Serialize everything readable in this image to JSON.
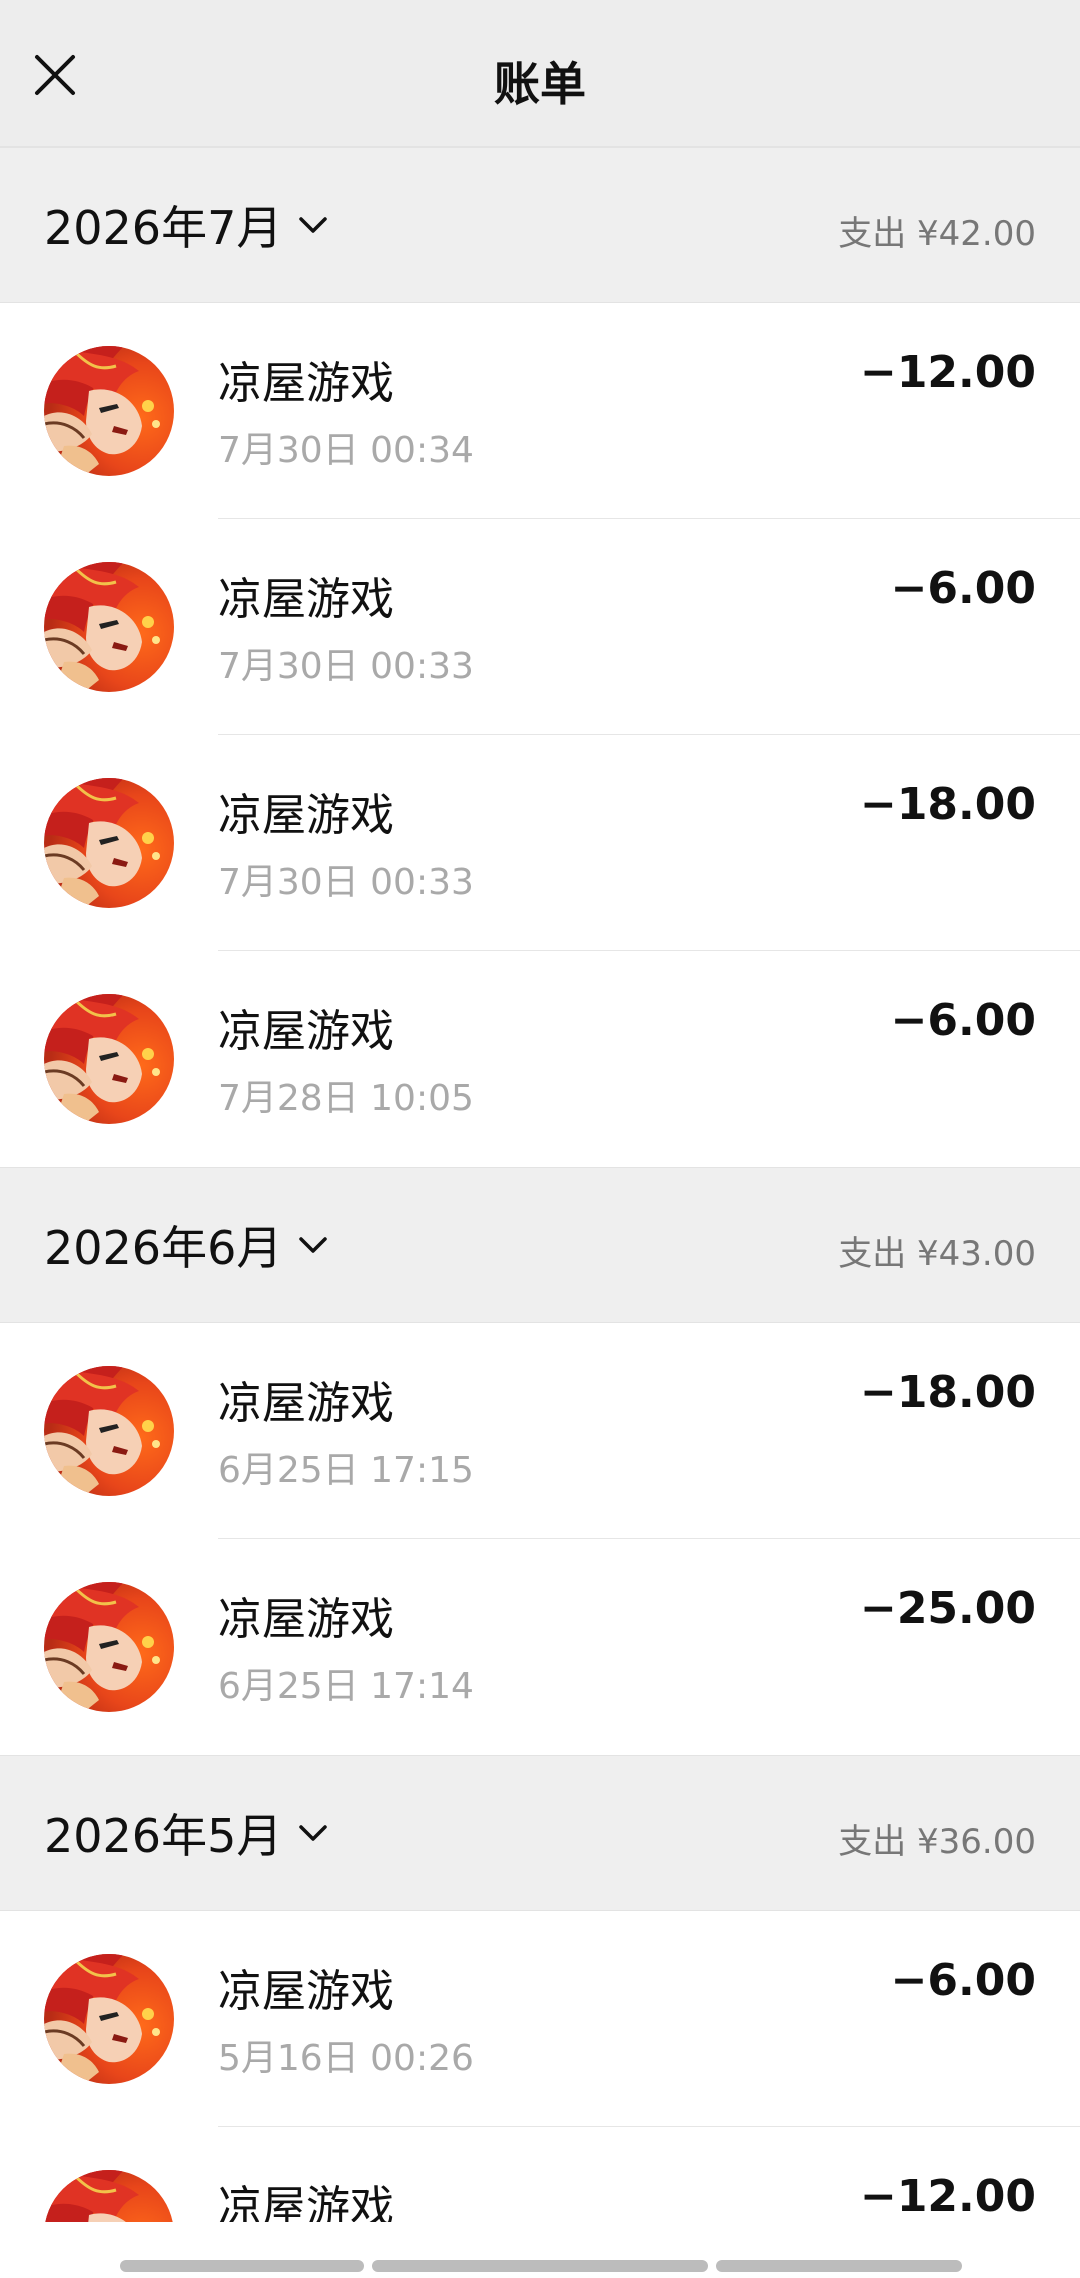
{
  "header": {
    "title": "账单",
    "close_icon": "close-icon"
  },
  "months": [
    {
      "label": "2026年7月",
      "total": "支出 ¥42.00",
      "bills": [
        {
          "merchant": "凉屋游戏",
          "time": "7月30日 00:34",
          "amount": "−12.00"
        },
        {
          "merchant": "凉屋游戏",
          "time": "7月30日 00:33",
          "amount": "−6.00"
        },
        {
          "merchant": "凉屋游戏",
          "time": "7月30日 00:33",
          "amount": "−18.00"
        },
        {
          "merchant": "凉屋游戏",
          "time": "7月28日 10:05",
          "amount": "−6.00"
        }
      ]
    },
    {
      "label": "2026年6月",
      "total": "支出 ¥43.00",
      "bills": [
        {
          "merchant": "凉屋游戏",
          "time": "6月25日 17:15",
          "amount": "−18.00"
        },
        {
          "merchant": "凉屋游戏",
          "time": "6月25日 17:14",
          "amount": "−25.00"
        }
      ]
    },
    {
      "label": "2026年5月",
      "total": "支出 ¥36.00",
      "bills": [
        {
          "merchant": "凉屋游戏",
          "time": "5月16日 00:26",
          "amount": "−6.00"
        },
        {
          "merchant": "凉屋游戏",
          "time": "",
          "amount": "−12.00"
        }
      ]
    }
  ],
  "colors": {
    "header_bg": "#ededed",
    "month_bg": "#efefef",
    "text_primary": "#111111",
    "text_secondary": "#a9a9a9",
    "total_text": "#777777"
  },
  "icons": {
    "month_toggle": "chevron-down-icon",
    "avatar": "game-avatar"
  }
}
